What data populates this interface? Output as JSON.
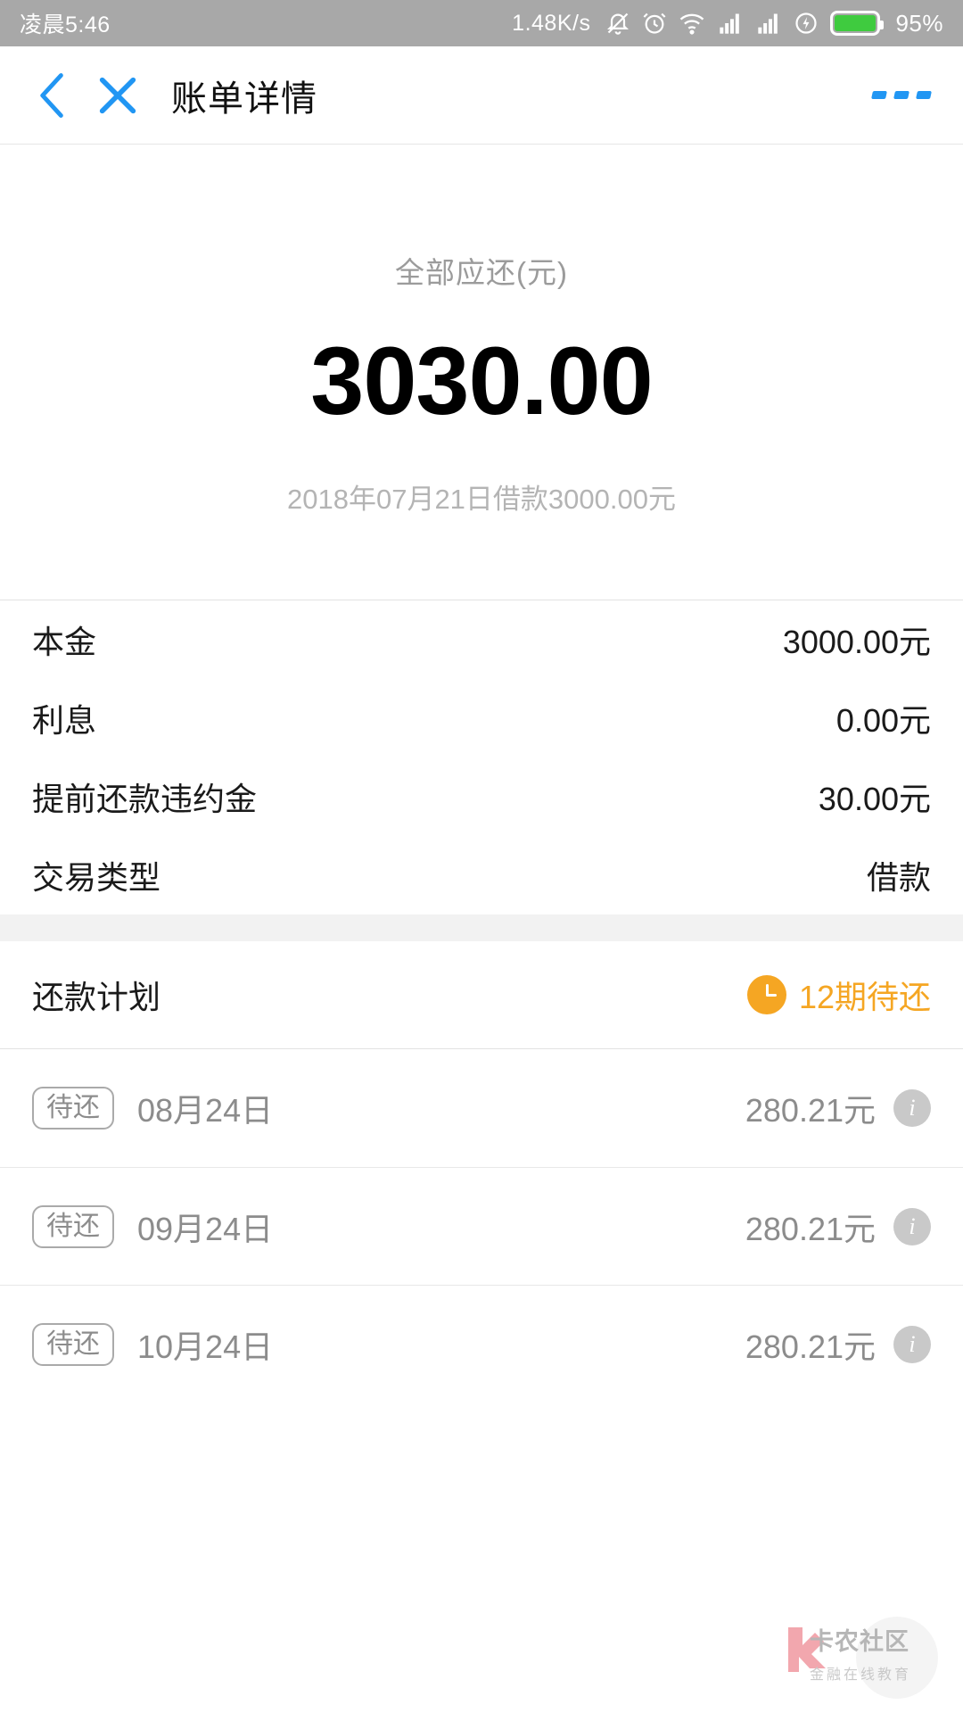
{
  "statusbar": {
    "time": "凌晨5:46",
    "network_speed": "1.48K/s",
    "battery_percent": "95%",
    "icons": [
      "bell-muted-icon",
      "alarm-clock-icon",
      "wifi-icon",
      "signal-bars-icon",
      "signal-bars-icon",
      "charging-bolt-icon",
      "battery-icon"
    ]
  },
  "header": {
    "back_icon": "back-chevron-icon",
    "close_icon": "close-x-icon",
    "title": "账单详情",
    "more_icon": "more-dots-icon",
    "accent_color": "#2196f3"
  },
  "summary": {
    "label": "全部应还(元)",
    "amount": "3030.00",
    "subtitle": "2018年07月21日借款3000.00元"
  },
  "details": {
    "rows": [
      {
        "label": "本金",
        "value": "3000.00元"
      },
      {
        "label": "利息",
        "value": "0.00元"
      },
      {
        "label": "提前还款违约金",
        "value": "30.00元"
      },
      {
        "label": "交易类型",
        "value": "借款"
      }
    ]
  },
  "plan": {
    "title": "还款计划",
    "status_icon": "clock-icon",
    "status_text": "12期待还",
    "status_color": "#f5a623",
    "installments": [
      {
        "badge": "待还",
        "date": "08月24日",
        "amount": "280.21元",
        "info_icon": "info-circle-icon"
      },
      {
        "badge": "待还",
        "date": "09月24日",
        "amount": "280.21元",
        "info_icon": "info-circle-icon"
      },
      {
        "badge": "待还",
        "date": "10月24日",
        "amount": "280.21元",
        "info_icon": "info-circle-icon"
      }
    ]
  },
  "watermark": {
    "name": "卡农社区",
    "subtitle": "金融在线教育",
    "mark_color": "#e8606d"
  }
}
